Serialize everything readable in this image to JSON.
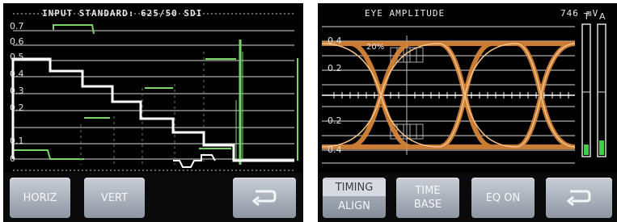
{
  "left_panel": {
    "header": "INPUT STANDARD: 625/50 SDI",
    "y_labels": [
      "0.7",
      "0.6",
      "0.5",
      "0.4",
      "0.3",
      "0.2",
      "0.1",
      "0"
    ],
    "buttons": {
      "horiz_label": "HORIZ",
      "vert_label": "VERT",
      "return_icon": "return-arrow-icon"
    }
  },
  "right_panel": {
    "title": "EYE AMPLITUDE",
    "amplitude_value": "746",
    "amplitude_unit": "mV",
    "y_labels": [
      "0.4",
      "0.2",
      "0.2",
      "0.4"
    ],
    "percent_marker": "20%",
    "meter_labels": [
      "T",
      "A"
    ],
    "buttons": {
      "timing_align_top": "TIMING",
      "timing_align_bottom": "ALIGN",
      "time_base_top": "TIME",
      "time_base_bottom": "BASE",
      "eq_on_label": "EQ ON",
      "return_icon": "return-arrow-icon"
    }
  },
  "colors": {
    "trace_white": "#ffffff",
    "trace_green": "#7bd36a",
    "eye_orange": "#e08a3a",
    "meter_green": "#3fcf45",
    "button_gray": "#a6adb8"
  }
}
